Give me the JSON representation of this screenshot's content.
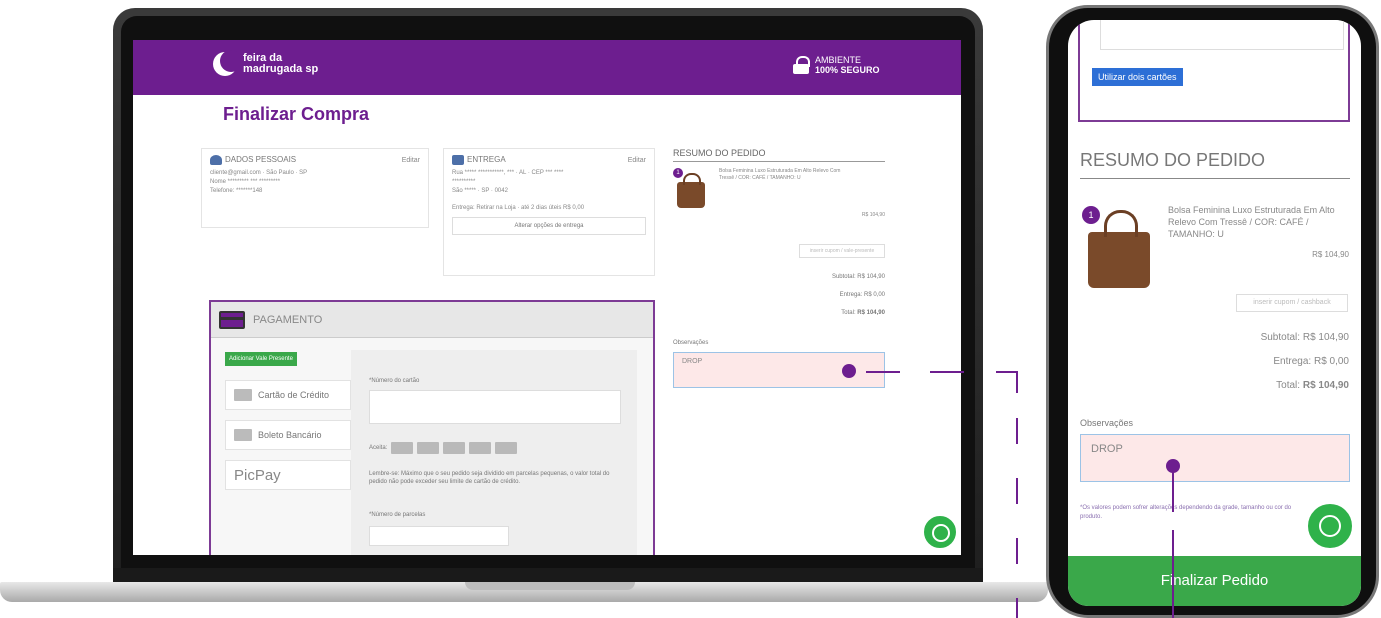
{
  "laptop": {
    "header": {
      "logo_line1": "feira da",
      "logo_line2": "madrugada sp",
      "secure_line1": "AMBIENTE",
      "secure_line2": "100% SEGURO"
    },
    "page_title": "Finalizar Compra",
    "dados_pessoais": {
      "title": "DADOS PESSOAIS",
      "edit": "Editar",
      "line1": "cliente@gmail.com · São Paulo · SP",
      "line2": "Nome ********* *** *********",
      "line3": "Telefone: *******148"
    },
    "entrega": {
      "title": "ENTREGA",
      "edit": "Editar",
      "line1": "Rua ***** ***********, *** · AL · CEP *** ****",
      "line2": "**********",
      "line3": "São ***** · SP · 0042",
      "line4": "Entrega: Retirar na Loja · até 2 dias úteis R$ 0,00",
      "button": "Alterar opções de entrega"
    },
    "resumo": {
      "title": "RESUMO DO PEDIDO",
      "qty": "1",
      "product": "Bolsa Feminina Luxo Estruturada Em Alto Relevo Com Tressê / COR: CAFÉ / TAMANHO: U",
      "price": "R$ 104,90",
      "coupon_placeholder": "inserir cupom / vale-presente",
      "subtotal_label": "Subtotal:",
      "subtotal_value": "R$ 104,90",
      "entrega_label": "Entrega:",
      "entrega_value": "R$ 0,00",
      "total_label": "Total:",
      "total_value": "R$ 104,90"
    },
    "observacoes": {
      "label": "Observações",
      "value": "DROP"
    },
    "pagamento": {
      "title": "PAGAMENTO",
      "vale_button": "Adicionar Vale Presente",
      "opt_credit": "Cartão de Crédito",
      "opt_boleto": "Boleto Bancário",
      "opt_picpay": "PicPay",
      "card_number_label": "*Número do cartão",
      "brands_label": "Aceita:",
      "notice": "Lembre-se: Máximo que o seu pedido seja dividido em parcelas pequenas, o valor total do pedido não pode exceder seu limite de cartão de crédito.",
      "installments_label": "*Número de parcelas"
    }
  },
  "phone": {
    "two_cards_button": "Utilizar dois cartões",
    "resumo_title": "RESUMO DO PEDIDO",
    "qty": "1",
    "product": "Bolsa Feminina Luxo Estruturada Em Alto Relevo Com Tressê / COR: CAFÉ / TAMANHO: U",
    "price": "R$ 104,90",
    "coupon_placeholder": "inserir cupom / cashback",
    "subtotal_label": "Subtotal:",
    "subtotal_value": "R$ 104,90",
    "entrega_label": "Entrega:",
    "entrega_value": "R$ 0,00",
    "total_label": "Total:",
    "total_value": "R$ 104,90",
    "obs_label": "Observações",
    "obs_value": "DROP",
    "note": "*Os valores podem sofrer alterações dependendo da grade, tamanho ou cor do produto.",
    "finalize_button": "Finalizar Pedido"
  },
  "colors": {
    "brand_purple": "#6d1e8f",
    "whatsapp_green": "#2fb24a",
    "finalize_green": "#3aa84a",
    "link_blue": "#2d6fd6"
  },
  "icons": [
    "moon-logo-icon",
    "lock-icon",
    "person-icon",
    "truck-icon",
    "credit-card-icon",
    "barcode-icon",
    "whatsapp-icon"
  ]
}
